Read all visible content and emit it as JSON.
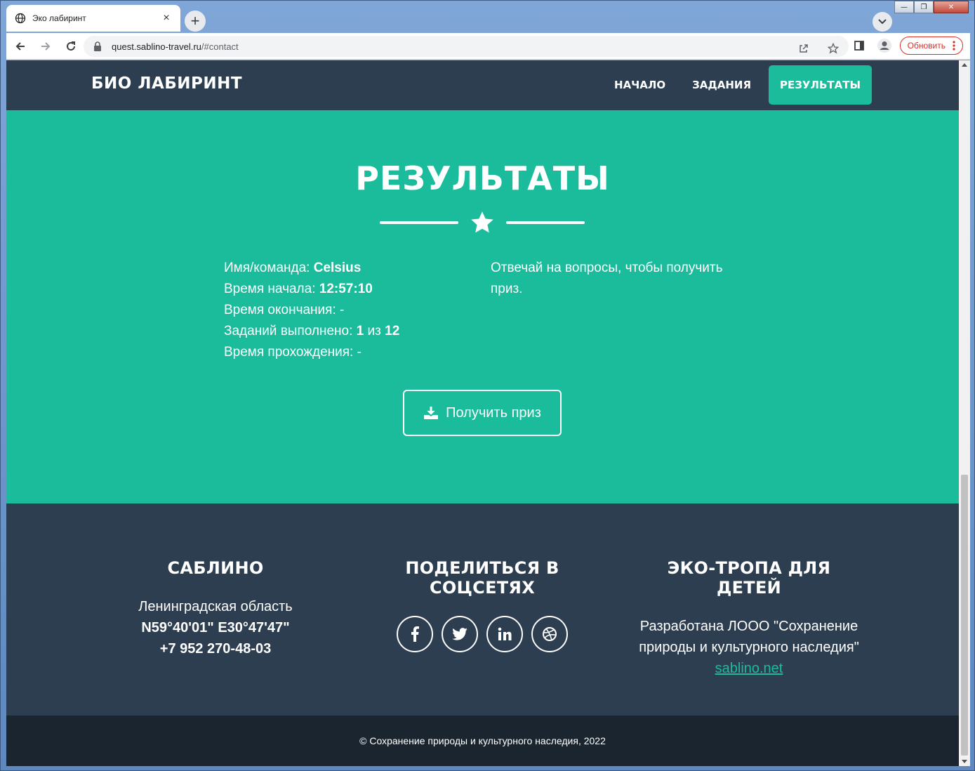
{
  "browser": {
    "tab_title": "Эко лабиринт",
    "tab_close": "×",
    "new_tab": "+",
    "url_host": "quest.sablino-travel.ru",
    "url_path": "/#contact",
    "update_label": "Обновить"
  },
  "site": {
    "brand": "БИО ЛАБИРИНТ",
    "nav": [
      {
        "label": "НАЧАЛО"
      },
      {
        "label": "ЗАДАНИЯ"
      },
      {
        "label": "РЕЗУЛЬТАТЫ",
        "active": true
      }
    ]
  },
  "results": {
    "heading": "РЕЗУЛЬТАТЫ",
    "team_label": "Имя/команда:",
    "team_value": "Celsius",
    "start_label": "Время начала:",
    "start_value": "12:57:10",
    "end_label": "Время окончания:",
    "end_value": "-",
    "done_label": "Заданий выполнено:",
    "done_value_a": "1",
    "done_of": "из",
    "done_value_b": "12",
    "duration_label": "Время прохождения:",
    "duration_value": "-",
    "hint": "Отвечай на вопросы, чтобы получить приз.",
    "prize_button": "Получить приз"
  },
  "footer": {
    "col1": {
      "title": "САБЛИНО",
      "region": "Ленинградская область",
      "coords": "N59°40'01\" E30°47'47\"",
      "phone": "+7 952 270-48-03"
    },
    "col2": {
      "title": "ПОДЕЛИТЬСЯ В СОЦСЕТЯХ",
      "socials": [
        "facebook-icon",
        "twitter-icon",
        "linkedin-icon",
        "dribbble-icon"
      ]
    },
    "col3": {
      "title": "ЭКО-ТРОПА ДЛЯ ДЕТЕЙ",
      "text": "Разработана ЛООО \"Сохранение природы и культурного наследия\"",
      "link": "sablino.net"
    }
  },
  "copyright": "© Сохранение природы и культурного наследия, 2022",
  "colors": {
    "teal": "#1abc9c",
    "navy": "#2c3e50",
    "dark": "#1a252f"
  }
}
